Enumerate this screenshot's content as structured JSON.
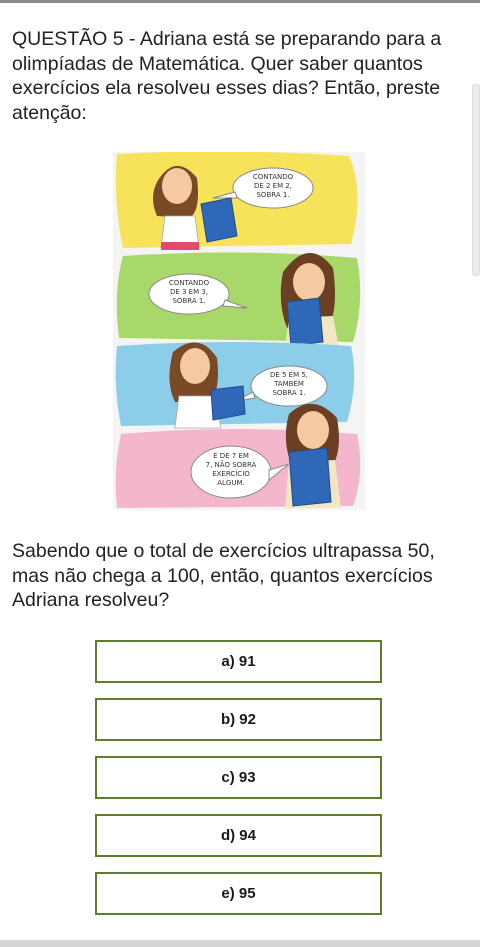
{
  "question": {
    "text": "QUESTÃO 5 - Adriana está se preparando para a olimpíadas de Matemática. Quer saber quantos exercícios ela resolveu esses dias? Então, preste atenção:"
  },
  "comic": {
    "panels": [
      {
        "bubble_lines": [
          "CONTANDO",
          "DE 2 EM 2,",
          "SOBRA 1."
        ],
        "background": "#f6e35a"
      },
      {
        "bubble_lines": [
          "CONTANDO",
          "DE 3 EM 3,",
          "SOBRA 1."
        ],
        "background": "#a9d86a"
      },
      {
        "bubble_lines": [
          "DE 5 EM 5,",
          "TAMBÉM",
          "SOBRA 1."
        ],
        "background": "#8ccdea"
      },
      {
        "bubble_lines": [
          "E DE 7 EM",
          "7, NÃO SOBRA",
          "EXERCÍCIO",
          "ALGUM."
        ],
        "background": "#f4b6cc"
      }
    ]
  },
  "prompt": {
    "text": "Sabendo que o total de exercícios ultrapassa 50, mas não chega a 100, então, quantos exercícios Adriana resolveu?"
  },
  "options": [
    {
      "label": "a) 91"
    },
    {
      "label": "b) 92"
    },
    {
      "label": "c) 93"
    },
    {
      "label": "d) 94"
    },
    {
      "label": "e) 95"
    }
  ],
  "colors": {
    "option_border": "#5d7f2b",
    "text": "#222222"
  }
}
